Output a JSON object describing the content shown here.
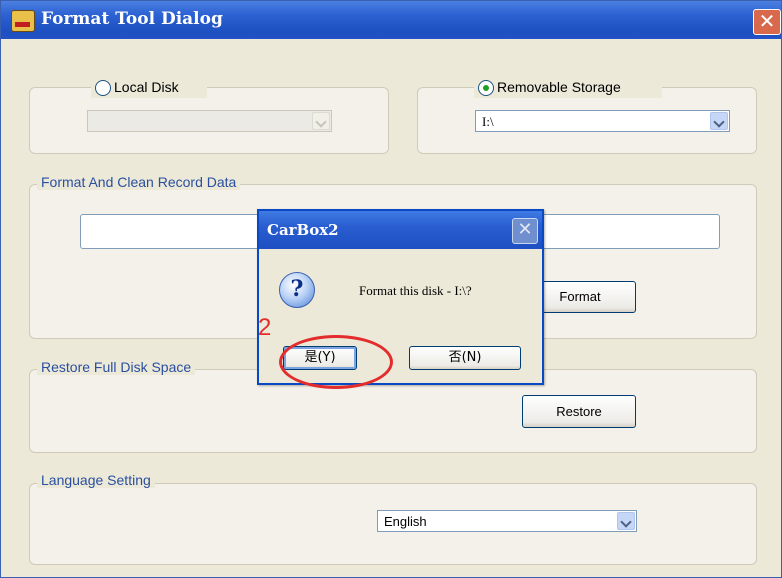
{
  "window": {
    "title": "Format Tool Dialog",
    "close_glyph": "✕"
  },
  "disk_select": {
    "local_disk_label": "Local Disk",
    "local_disk_value": "",
    "removable_label": "Removable Storage",
    "removable_value": "I:\\",
    "selected": "removable"
  },
  "format_group": {
    "legend": "Format And Clean Record Data",
    "progress_percent": 0,
    "format_button": "Format"
  },
  "restore_group": {
    "legend": "Restore Full Disk Space",
    "restore_button": "Restore"
  },
  "language_group": {
    "legend": "Language Setting",
    "value": "English"
  },
  "message_box": {
    "title": "CarBox2",
    "close_glyph": "✕",
    "icon": "question-icon",
    "icon_glyph": "?",
    "message": "Format this disk - I:\\?",
    "yes_button": "是(Y)",
    "no_button": "否(N)"
  },
  "annotation": {
    "step_number": "2",
    "color": "#e32d2d"
  },
  "colors": {
    "titlebar": "#2d62d4",
    "dialog_bg": "#ece9d8",
    "legend_text": "#2a4fa0"
  }
}
